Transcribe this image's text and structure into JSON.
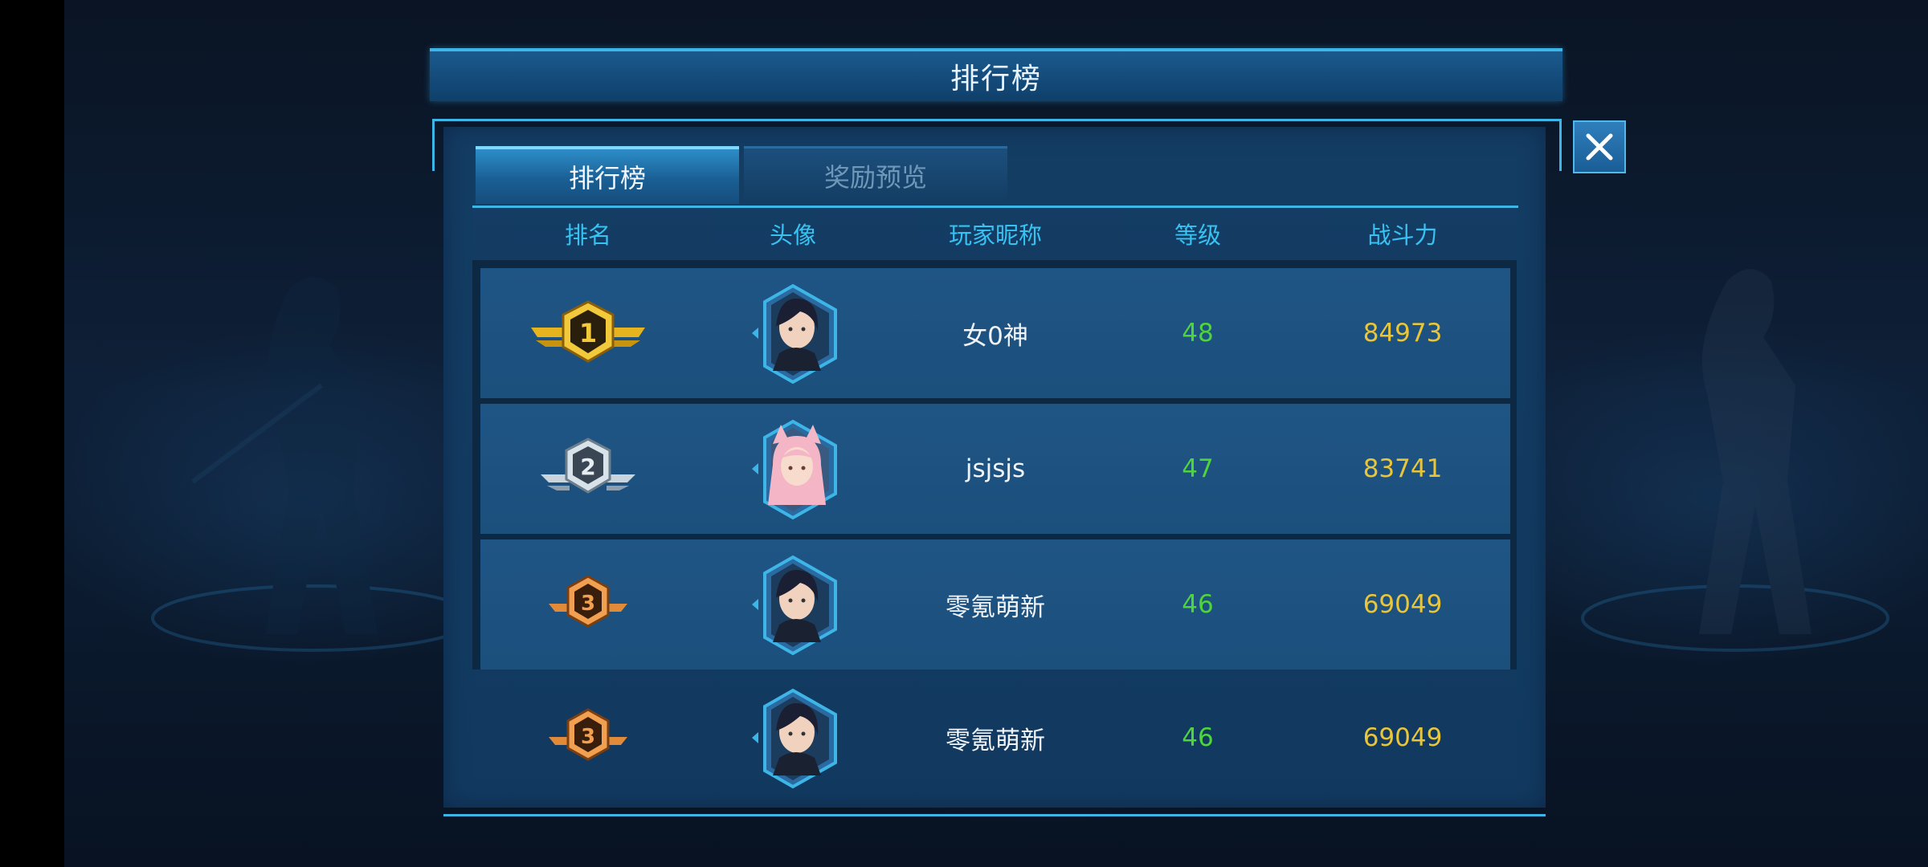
{
  "title": "排行榜",
  "tabs": [
    {
      "label": "排行榜",
      "active": true
    },
    {
      "label": "奖励预览",
      "active": false
    }
  ],
  "columns": {
    "rank": "排名",
    "avatar": "头像",
    "nickname": "玩家昵称",
    "level": "等级",
    "power": "战斗力"
  },
  "rows": [
    {
      "rank": "1",
      "badge": "gold-rank-badge",
      "avatar": "dark-haired-girl-avatar",
      "nickname": "女0神",
      "level": "48",
      "power": "84973"
    },
    {
      "rank": "2",
      "badge": "silver-rank-badge",
      "avatar": "pink-haired-catgirl-avatar",
      "nickname": "jsjsjs",
      "level": "47",
      "power": "83741"
    },
    {
      "rank": "3",
      "badge": "bronze-rank-badge",
      "avatar": "dark-haired-girl-avatar",
      "nickname": "零氪萌新",
      "level": "46",
      "power": "69049"
    },
    {
      "rank": "3",
      "badge": "bronze-rank-badge",
      "avatar": "dark-haired-girl-avatar",
      "nickname": "零氪萌新",
      "level": "46",
      "power": "69049"
    }
  ],
  "colors": {
    "accent": "#3db5e6",
    "header_text": "#37c2f2",
    "level_text": "#4fd43b",
    "power_text": "#e8c53a",
    "gold": "#e6b41e",
    "silver": "#c8d4de",
    "bronze": "#e08a3a"
  },
  "icons": {
    "close": "close-icon"
  }
}
